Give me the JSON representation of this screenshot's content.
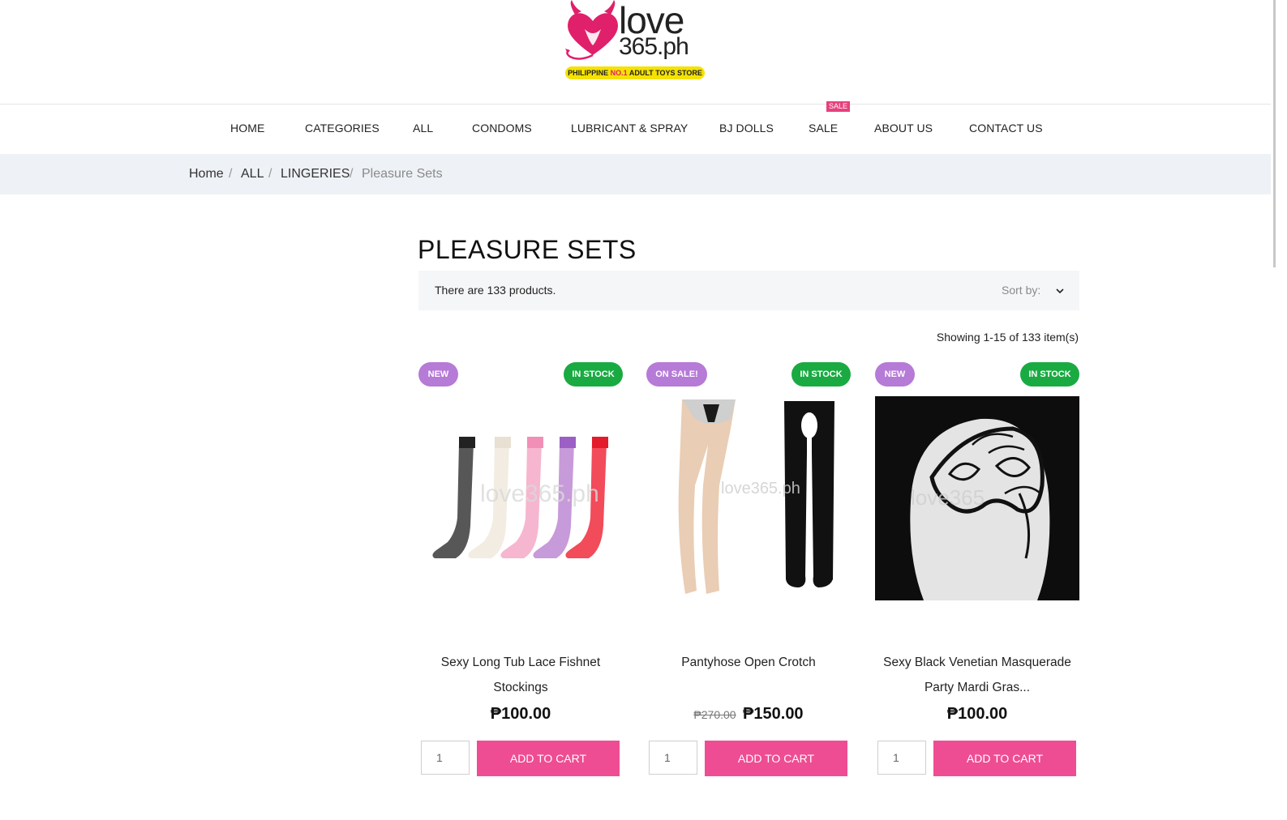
{
  "logo": {
    "line1": "love",
    "line2": "365.ph",
    "tagline_pre": "PHILIPPINE ",
    "tagline_no1": "NO.1",
    "tagline_post": " ADULT TOYS STORE",
    "brand_color": "#e0206b"
  },
  "nav": {
    "items": [
      "HOME",
      "CATEGORIES",
      "ALL",
      "CONDOMS",
      "LUBRICANT & SPRAY",
      "BJ DOLLS",
      "SALE",
      "ABOUT US",
      "CONTACT US"
    ],
    "sale_badge": "SALE"
  },
  "breadcrumb": {
    "items": [
      "Home",
      "ALL",
      "LINGERIES"
    ],
    "current": "Pleasure Sets",
    "separator": "/"
  },
  "page": {
    "title": "PLEASURE SETS",
    "product_count_text": "There are 133 products.",
    "sort_label": "Sort by:",
    "showing_text": "Showing 1-15 of 133 item(s)"
  },
  "products": [
    {
      "badge_left": "NEW",
      "badge_right": "IN STOCK",
      "name_line1": "Sexy Long Tub Lace Fishnet",
      "name_line2": "Stockings",
      "old_price": "",
      "price": "₱100.00",
      "qty": "1",
      "button": "ADD TO CART",
      "watermark": "love365.ph"
    },
    {
      "badge_left": "ON SALE!",
      "badge_right": "IN STOCK",
      "name_line1": "Pantyhose Open Crotch",
      "name_line2": "",
      "old_price": "₱270.00",
      "price": "₱150.00",
      "qty": "1",
      "button": "ADD TO CART",
      "watermark": "love365.ph"
    },
    {
      "badge_left": "NEW",
      "badge_right": "IN STOCK",
      "name_line1": "Sexy Black Venetian Masquerade",
      "name_line2": "Party Mardi Gras...",
      "old_price": "",
      "price": "₱100.00",
      "qty": "1",
      "button": "ADD TO CART",
      "watermark": "love365"
    }
  ],
  "colors": {
    "accent_pink": "#ee4d93",
    "badge_purple": "#b67ad7",
    "badge_green": "#1aaa42",
    "breadcrumb_bg": "#eef1f5"
  }
}
